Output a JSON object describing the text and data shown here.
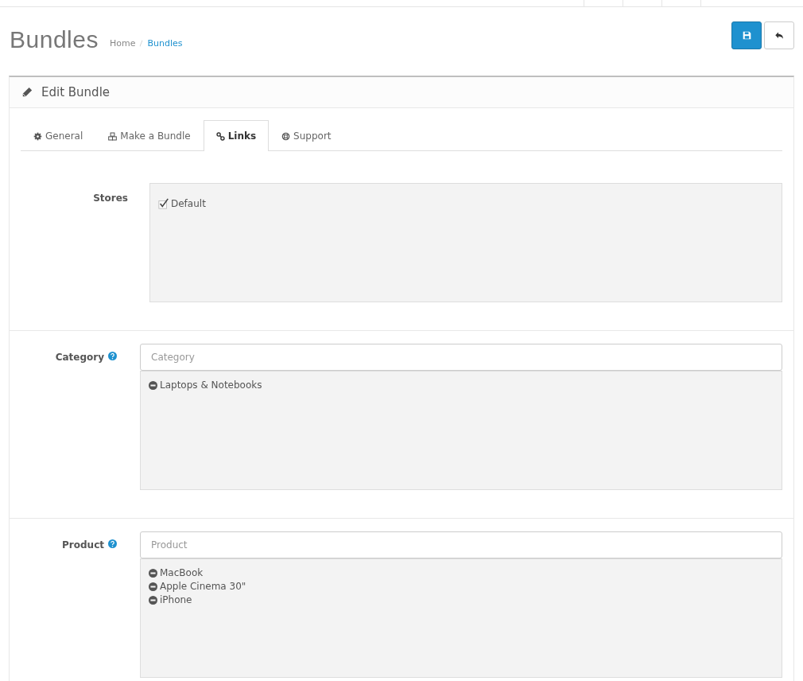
{
  "page_title": "Bundles",
  "breadcrumb": [
    {
      "label": "Home",
      "selected": false
    },
    {
      "label": "Bundles",
      "selected": true
    }
  ],
  "panel_title": "Edit Bundle",
  "tabs": [
    {
      "label": "General",
      "selected": false
    },
    {
      "label": "Make a Bundle",
      "selected": false
    },
    {
      "label": "Links",
      "selected": true
    },
    {
      "label": "Support",
      "selected": false
    }
  ],
  "stores": {
    "label": "Stores",
    "options": [
      {
        "label": "Default",
        "checked": true
      }
    ]
  },
  "fields": [
    {
      "label": "Category",
      "help": true,
      "placeholder": "Category",
      "items": [
        "Laptops & Notebooks"
      ]
    },
    {
      "label": "Product",
      "help": true,
      "placeholder": "Product",
      "items": [
        "MacBook",
        "Apple Cinema 30\"",
        "iPhone"
      ]
    }
  ]
}
